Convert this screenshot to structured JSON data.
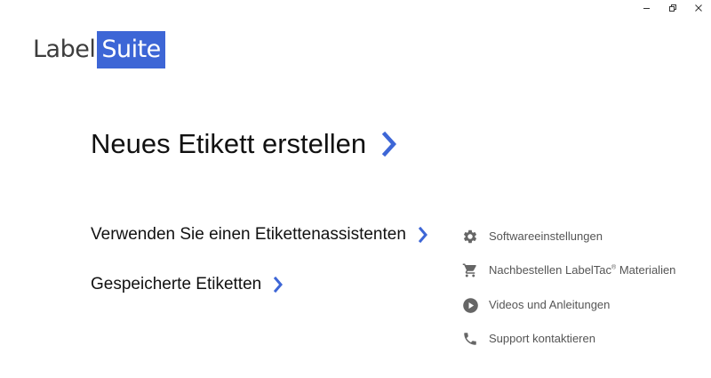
{
  "window": {
    "controls": [
      "minimize",
      "restore",
      "close"
    ]
  },
  "logo": {
    "part1": "Label",
    "part2": "Suite",
    "accent_color": "#3d66d6"
  },
  "main": {
    "new_label": "Neues Etikett erstellen",
    "wizard": "Verwenden Sie einen Etikettenassistenten",
    "saved": "Gespeicherte Etiketten",
    "chevron_color": "#3d66d6"
  },
  "links": {
    "settings": "Softwareeinstellungen",
    "reorder_prefix": "Nachbestellen LabelTac",
    "reorder_mark": "®",
    "reorder_suffix": " Materialien",
    "videos": "Videos und Anleitungen",
    "support": "Support kontaktieren",
    "icons": [
      "gear-icon",
      "cart-icon",
      "play-circle-icon",
      "phone-icon"
    ]
  }
}
